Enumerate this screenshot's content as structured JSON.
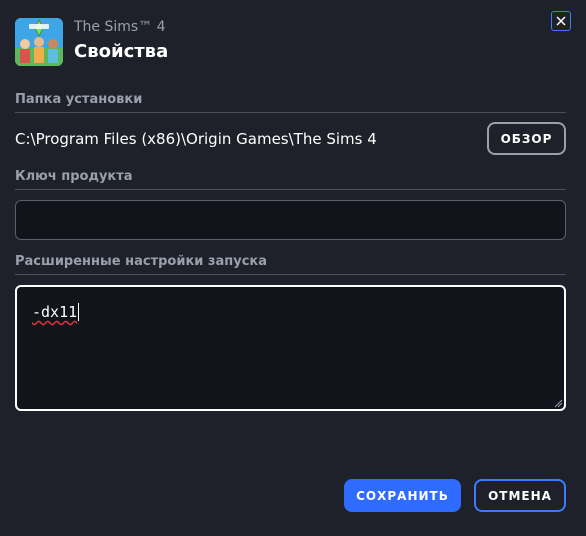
{
  "header": {
    "game_name": "The Sims™ 4",
    "title": "Свойства",
    "icon": "the-sims-4-cover-art"
  },
  "close": {
    "icon": "close-icon"
  },
  "install_folder": {
    "label": "Папка установки",
    "path": "C:\\Program Files (x86)\\Origin Games\\The Sims 4",
    "browse_label": "ОБЗОР"
  },
  "product_key": {
    "label": "Ключ продукта",
    "value": ""
  },
  "launch_options": {
    "label": "Расширенные настройки запуска",
    "value": "-dx11"
  },
  "actions": {
    "save_label": "СОХРАНИТЬ",
    "cancel_label": "ОТМЕНА"
  },
  "colors": {
    "background": "#1e2129",
    "input_background": "#12141b",
    "accent": "#2f6bff",
    "muted_text": "#9aa0ab",
    "spellcheck": "#e0323c"
  }
}
